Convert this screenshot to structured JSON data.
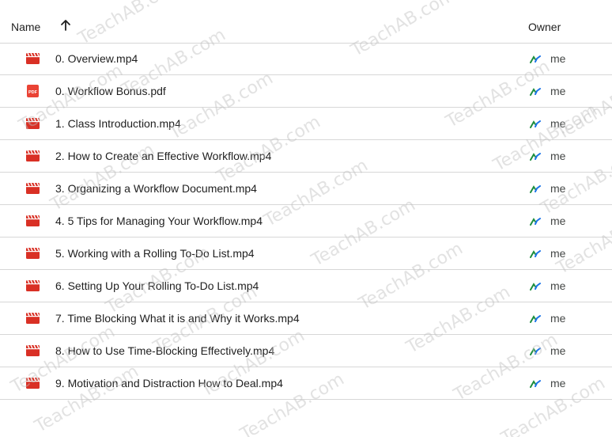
{
  "header": {
    "name_label": "Name",
    "owner_label": "Owner",
    "sort_icon": "arrow-up-icon"
  },
  "files": [
    {
      "name": "0. Overview.mp4",
      "type": "video",
      "owner": "me"
    },
    {
      "name": "0. Workflow Bonus.pdf",
      "type": "pdf",
      "owner": "me"
    },
    {
      "name": "1. Class Introduction.mp4",
      "type": "video",
      "owner": "me"
    },
    {
      "name": "2. How to Create an Effective Workflow.mp4",
      "type": "video",
      "owner": "me"
    },
    {
      "name": "3. Organizing a Workflow Document.mp4",
      "type": "video",
      "owner": "me"
    },
    {
      "name": "4. 5 Tips for Managing Your Workflow.mp4",
      "type": "video",
      "owner": "me"
    },
    {
      "name": "5. Working with a Rolling To-Do List.mp4",
      "type": "video",
      "owner": "me"
    },
    {
      "name": "6. Setting Up Your Rolling To-Do List.mp4",
      "type": "video",
      "owner": "me"
    },
    {
      "name": "7. Time Blocking What it is and Why it Works.mp4",
      "type": "video",
      "owner": "me"
    },
    {
      "name": "8. How to Use Time-Blocking Effectively.mp4",
      "type": "video",
      "owner": "me"
    },
    {
      "name": "9. Motivation and Distraction How to Deal.mp4",
      "type": "video",
      "owner": "me"
    }
  ],
  "watermark": "TeachAB.com",
  "colors": {
    "video_icon": "#d93025",
    "pdf_icon": "#ea4335",
    "owner_green": "#1e8e3e",
    "owner_blue": "#1a73e8",
    "divider": "#d7d7d7"
  }
}
